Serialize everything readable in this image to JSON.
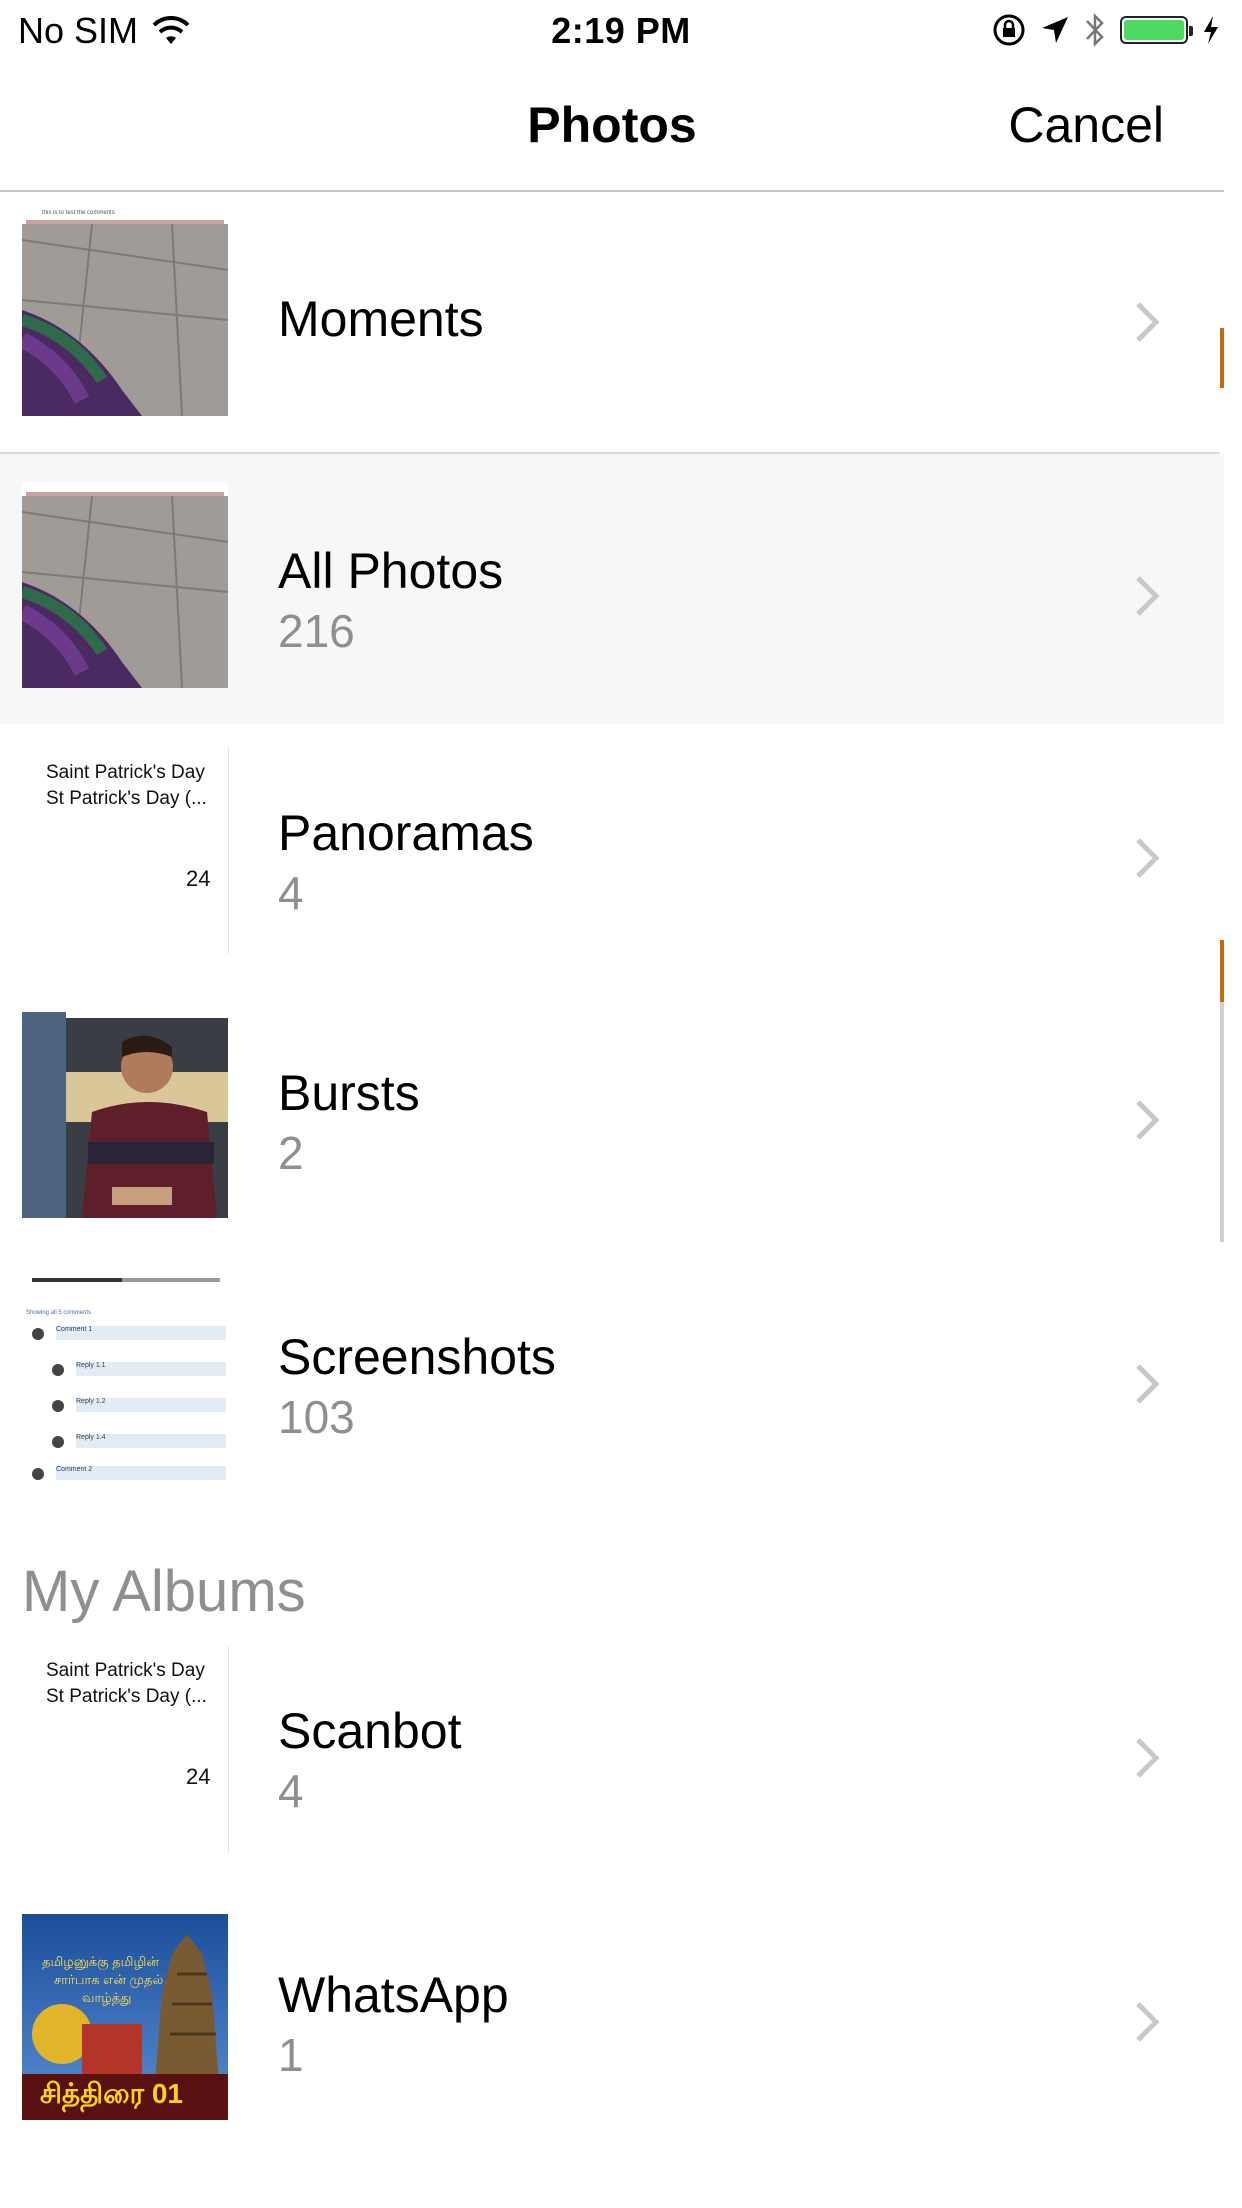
{
  "status_bar": {
    "carrier": "No SIM",
    "time": "2:19 PM",
    "battery_level": 1.0,
    "icons": [
      "wifi-icon",
      "orientation-lock-icon",
      "location-arrow-icon",
      "bluetooth-icon",
      "battery-icon",
      "charging-bolt-icon"
    ]
  },
  "nav": {
    "title": "Photos",
    "cancel_label": "Cancel"
  },
  "albums": [
    {
      "title": "Moments",
      "count": ""
    },
    {
      "title": "All Photos",
      "count": "216"
    },
    {
      "title": "Panoramas",
      "count": "4"
    },
    {
      "title": "Bursts",
      "count": "2"
    },
    {
      "title": "Screenshots",
      "count": "103"
    }
  ],
  "my_albums_header": "My Albums",
  "my_albums": [
    {
      "title": "Scanbot",
      "count": "4"
    },
    {
      "title": "WhatsApp",
      "count": "1"
    }
  ],
  "thumbnails": {
    "moments_caption": "this is to test the comments",
    "doc_line1": "Saint Patrick's Day",
    "doc_line2": "St Patrick's Day (...",
    "doc_number": "24",
    "screenshot_header": "Showing all 5 comments",
    "screenshot_comments": [
      "Comment 1",
      "Reply 1.1",
      "Reply 1.2",
      "Reply 1.4",
      "Comment 2"
    ],
    "whatsapp_banner": "சித்திரை 01",
    "whatsapp_line1": "தமிழனுக்கு தமிழின்",
    "whatsapp_line2": "சார்பாக என் முதல்",
    "whatsapp_line3": "வாழ்த்து"
  }
}
